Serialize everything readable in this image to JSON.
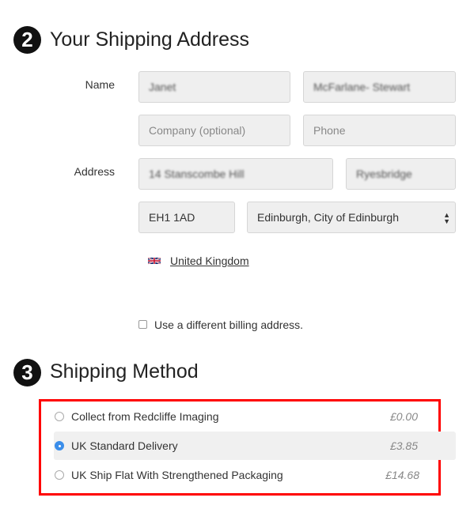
{
  "address_section": {
    "step": "2",
    "title": "Your Shipping Address",
    "name_label": "Name",
    "address_label": "Address",
    "first_name": "Janet",
    "last_name": "McFarlane- Stewart",
    "company_placeholder": "Company (optional)",
    "phone_placeholder": "Phone",
    "street": "14 Stanscombe Hill",
    "city": "Ryesbridge",
    "postcode": "EH1 1AD",
    "region": "Edinburgh, City of Edinburgh",
    "country": "United Kingdom",
    "billing_checkbox_label": "Use a different billing address.",
    "billing_checked": false
  },
  "shipping_section": {
    "step": "3",
    "title": "Shipping Method",
    "highlight_color": "#ff0000",
    "options": [
      {
        "label": "Collect from Redcliffe Imaging",
        "price": "£0.00",
        "selected": false
      },
      {
        "label": "UK Standard Delivery",
        "price": "£3.85",
        "selected": true
      },
      {
        "label": "UK Ship Flat With Strengthened Packaging",
        "price": "£14.68",
        "selected": false
      }
    ]
  }
}
